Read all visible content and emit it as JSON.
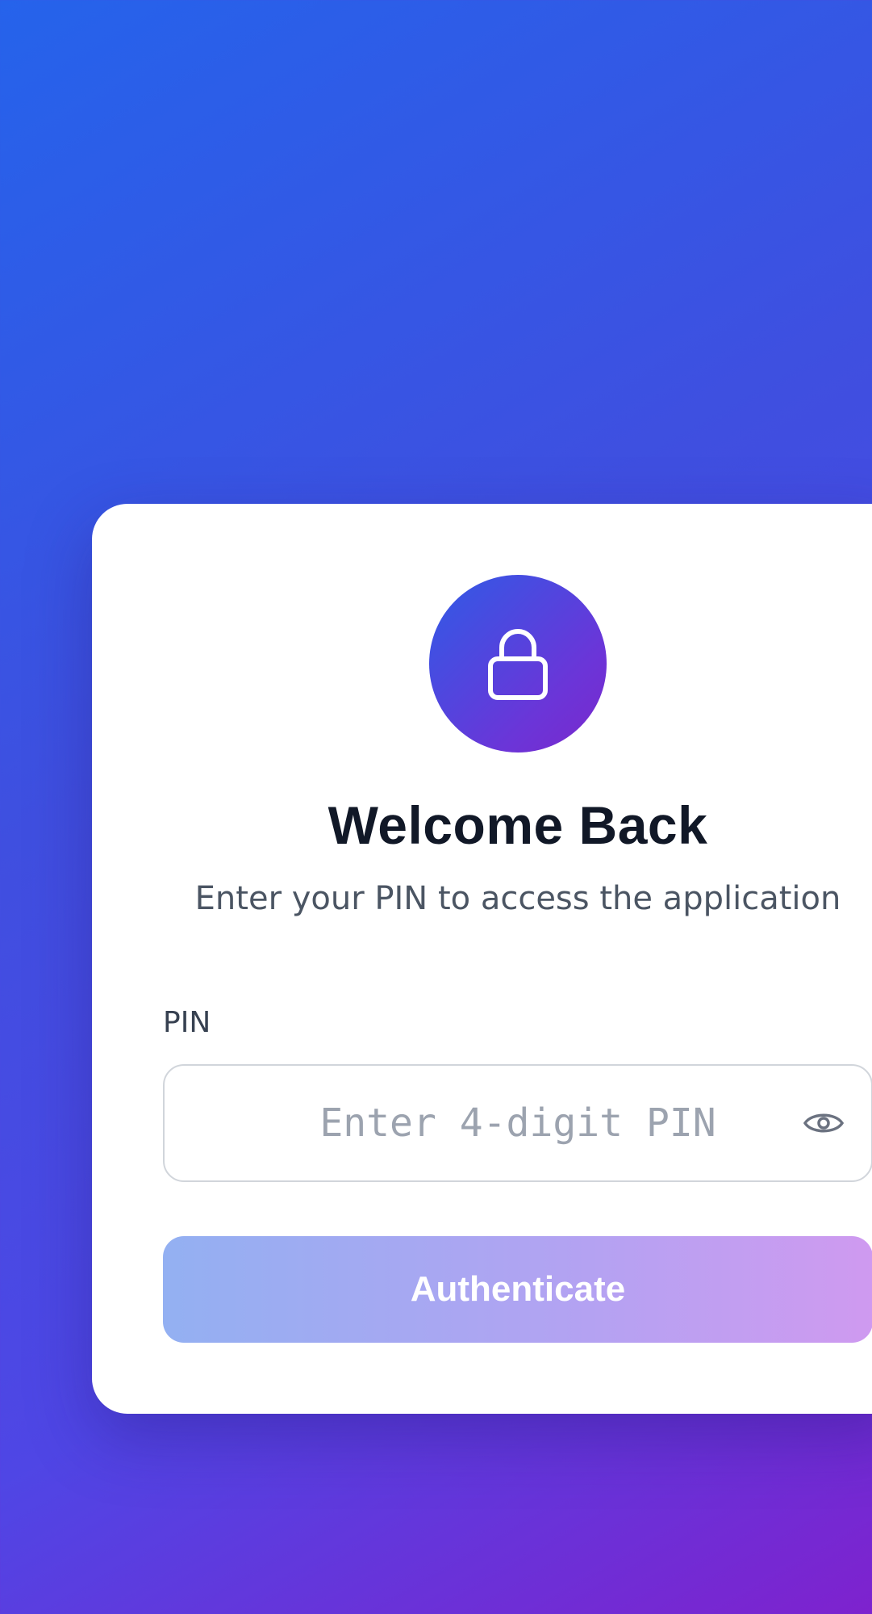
{
  "login": {
    "lock_icon": "lock-icon",
    "title": "Welcome Back",
    "subtitle": "Enter your PIN to access the application",
    "pin_label": "PIN",
    "pin_placeholder": "Enter 4-digit PIN",
    "pin_value": "",
    "visibility_icon": "eye-icon",
    "submit_label": "Authenticate",
    "submit_enabled": false
  },
  "colors": {
    "background_start": "#2563eb",
    "background_end": "#7e22ce",
    "title": "#111827",
    "subtitle": "#4b5563",
    "placeholder": "#9ca3af",
    "button_start": "#93b0f2",
    "button_end": "#cf9af0"
  }
}
